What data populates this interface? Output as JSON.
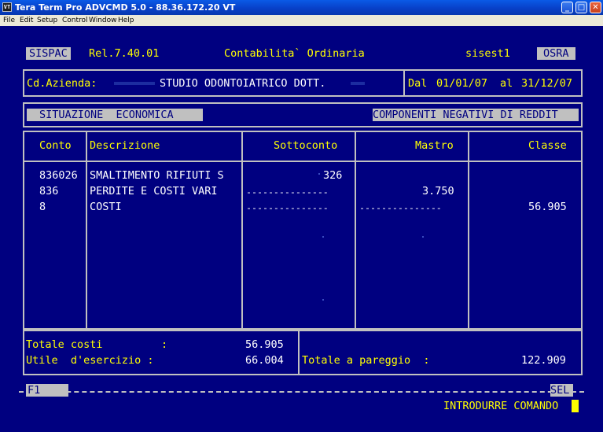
{
  "window": {
    "title": "Tera Term Pro ADVCMD 5.0 - 88.36.172.20 VT",
    "icon": "VT",
    "minimize": "_",
    "maximize": "□",
    "close": "✕"
  },
  "menu": [
    "File",
    "Edit",
    "Setup",
    "Control",
    "Window",
    "Help"
  ],
  "header": {
    "system": "SISPAC",
    "release": "Rel.7.40.01",
    "module": "Contabilita` Ordinaria",
    "host": "sisest1",
    "code": "OSRA"
  },
  "company": {
    "label": "Cd.Azienda:",
    "name": "STUDIO ODONTOIATRICO DOTT.",
    "period_from_label": "Dal",
    "from": "01/01/07",
    "period_to_label": "al",
    "to": "31/12/07"
  },
  "section": {
    "left": "SITUAZIONE  ECONOMICA",
    "right": "COMPONENTI NEGATIVI DI REDDIT"
  },
  "table": {
    "columns": [
      "Conto",
      "Descrizione",
      "Sottoconto",
      "Mastro",
      "Classe"
    ],
    "rows": [
      {
        "conto": "836026",
        "descrizione": "SMALTIMENTO RIFIUTI S",
        "sottoconto": "326",
        "mastro": "",
        "classe": ""
      },
      {
        "conto": "836",
        "descrizione": "PERDITE E COSTI VARI",
        "sottoconto": "---------------",
        "mastro": "3.750",
        "classe": ""
      },
      {
        "conto": "8",
        "descrizione": "COSTI",
        "sottoconto": "---------------",
        "mastro": "---------------",
        "classe": "56.905"
      }
    ]
  },
  "totals": {
    "costi_label": "Totale costi",
    "costi_sep": ":",
    "costi_value": "56.905",
    "utile_label": "Utile  d'esercizio :",
    "utile_value": "66.004",
    "pareggio_label": "Totale a pareggio  :",
    "pareggio_value": "122.909"
  },
  "footer": {
    "f1": "F1",
    "sel": "SEL",
    "prompt": "INTRODURRE COMANDO"
  }
}
